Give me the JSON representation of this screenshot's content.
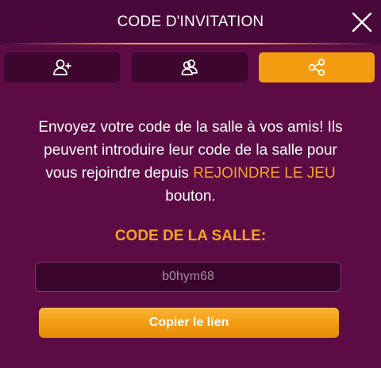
{
  "header": {
    "title": "CODE D'INVITATION",
    "close_icon": "close-icon"
  },
  "tabs": [
    {
      "icon": "add-user-icon",
      "active": false
    },
    {
      "icon": "friends-icon",
      "active": false
    },
    {
      "icon": "share-icon",
      "active": true
    }
  ],
  "message": {
    "text_before": "Envoyez votre code de la salle à vos amis! Ils peuvent introduire leur code de la salle pour vous rejoindre depuis ",
    "highlight": "REJOINDRE LE JEU",
    "text_after": " bouton."
  },
  "room": {
    "label": "CODE DE LA SALLE:",
    "code": "b0hym68"
  },
  "copy_button": {
    "label": "Copier le lien"
  },
  "colors": {
    "background": "#5c0b45",
    "header": "#48083a",
    "accent": "#f5a22a",
    "tab_inactive": "#3e062f",
    "tab_active": "#f39c12"
  }
}
